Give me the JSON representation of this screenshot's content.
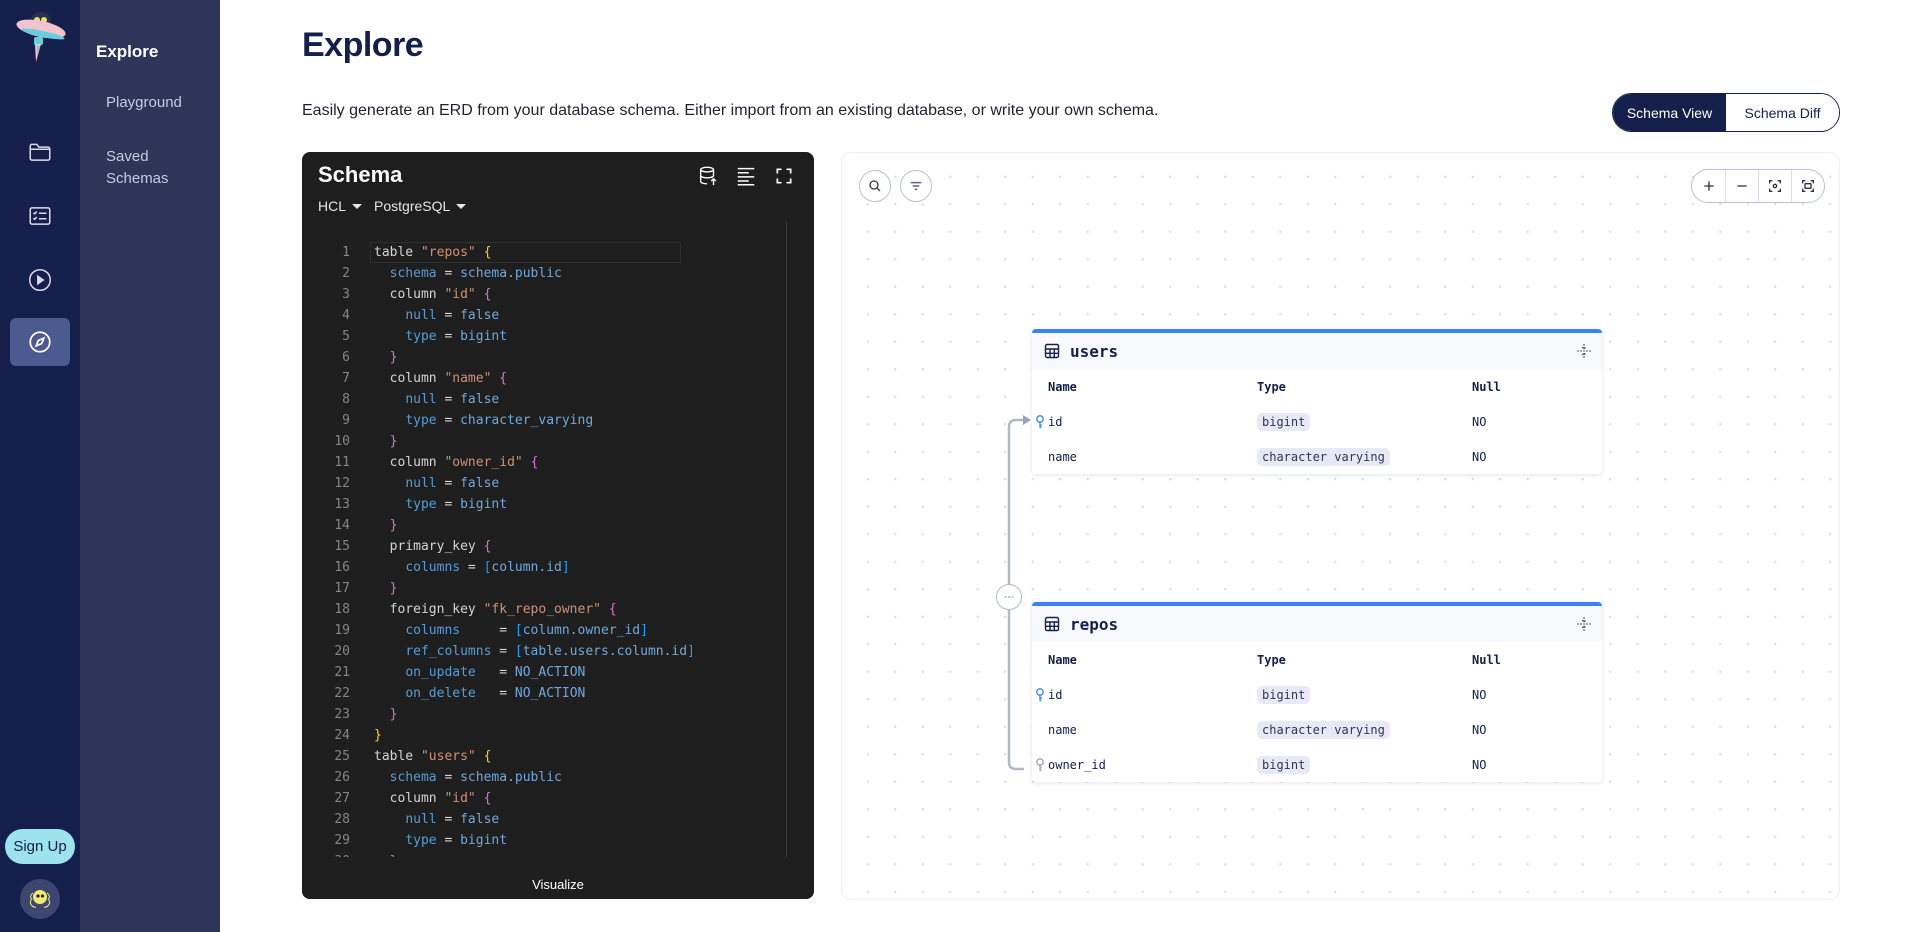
{
  "sidebar": {
    "logo": "ufo-mascot-logo",
    "rail_items": [
      {
        "name": "projects",
        "icon": "folder-icon"
      },
      {
        "name": "migrations",
        "icon": "checklist-icon"
      },
      {
        "name": "runs",
        "icon": "play-circle-icon"
      },
      {
        "name": "explore",
        "icon": "compass-icon",
        "active": true
      }
    ],
    "signup_label": "Sign Up",
    "avatar": "user-avatar"
  },
  "subnav": {
    "title": "Explore",
    "items": [
      {
        "label": "Playground"
      },
      {
        "label": "Saved\nSchemas",
        "line1": "Saved",
        "line2": "Schemas"
      }
    ]
  },
  "header": {
    "title": "Explore",
    "description": "Easily generate an ERD from your database schema. Either import from an existing database, or write your own schema.",
    "view_toggle": [
      {
        "label": "Schema View",
        "active": true
      },
      {
        "label": "Schema Diff",
        "active": false
      }
    ]
  },
  "editor": {
    "title": "Schema",
    "tools": [
      "database-import-icon",
      "format-align-icon",
      "fullscreen-icon"
    ],
    "language": "HCL",
    "dialect": "PostgreSQL",
    "visualize_label": "Visualize",
    "lines": [
      "table \"repos\" {",
      "  schema = schema.public",
      "  column \"id\" {",
      "    null = false",
      "    type = bigint",
      "  }",
      "  column \"name\" {",
      "    null = false",
      "    type = character_varying",
      "  }",
      "  column \"owner_id\" {",
      "    null = false",
      "    type = bigint",
      "  }",
      "  primary_key {",
      "    columns = [column.id]",
      "  }",
      "  foreign_key \"fk_repo_owner\" {",
      "    columns     = [column.owner_id]",
      "    ref_columns = [table.users.column.id]",
      "    on_update   = NO_ACTION",
      "    on_delete   = NO_ACTION",
      "  }",
      "}",
      "table \"users\" {",
      "  schema = schema.public",
      "  column \"id\" {",
      "    null = false",
      "    type = bigint",
      "  }"
    ]
  },
  "diagram": {
    "toolbar_left": [
      "search-icon",
      "filter-icon"
    ],
    "toolbar_right": [
      "zoom-in-icon",
      "zoom-out-icon",
      "focus-icon",
      "fit-view-icon"
    ],
    "column_headers": {
      "name": "Name",
      "type": "Type",
      "null": "Null"
    },
    "tables": [
      {
        "name": "users",
        "columns": [
          {
            "name": "id",
            "type": "bigint",
            "null": "NO",
            "key": "primary"
          },
          {
            "name": "name",
            "type": "character varying",
            "null": "NO",
            "key": ""
          }
        ]
      },
      {
        "name": "repos",
        "columns": [
          {
            "name": "id",
            "type": "bigint",
            "null": "NO",
            "key": "primary"
          },
          {
            "name": "name",
            "type": "character varying",
            "null": "NO",
            "key": ""
          },
          {
            "name": "owner_id",
            "type": "bigint",
            "null": "NO",
            "key": "foreign"
          }
        ]
      }
    ],
    "relations": [
      {
        "from": "repos.owner_id",
        "to": "users.id",
        "label_icon": "more-horizontal-icon"
      }
    ],
    "colors": {
      "accent": "#3b82f6",
      "primary_key": "#3b82f6",
      "foreign_key": "#9aa3b5",
      "edge": "#b1b9c4"
    }
  }
}
